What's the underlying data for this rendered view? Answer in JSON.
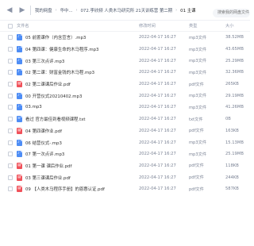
{
  "breadcrumb": [
    "我的网盘",
    "华中...",
    "072.李欣频 人类木马研究所 21天训练营 第二期",
    "01 主课"
  ],
  "search": {
    "placeholder": "搜索我的网盘文件"
  },
  "columns": {
    "name": "文件名",
    "modified": "修改时间",
    "type": "类型",
    "size": "大小"
  },
  "files": [
    {
      "name": "05 前置课作（内含宣言）.mp3",
      "modified": "2022-04-17 16:27",
      "type": "mp3文件",
      "size": "38.52MB",
      "icon": "audio"
    },
    {
      "name": "04 第四课：健康生命的木马程序.mp3",
      "modified": "2022-04-17 16:27",
      "type": "mp3文件",
      "size": "43.65MB",
      "icon": "audio"
    },
    {
      "name": "03 第三次点评.mp3",
      "modified": "2022-04-17 16:27",
      "type": "mp3文件",
      "size": "25.29MB",
      "icon": "audio"
    },
    {
      "name": "02 第二课：财富金钱的木马程.mp3",
      "modified": "2022-04-17 16:27",
      "type": "mp3文件",
      "size": "32.36MB",
      "icon": "audio"
    },
    {
      "name": "02 第二课课后作业.pdf",
      "modified": "2022-04-17 16:27",
      "type": "pdf文件",
      "size": "265KB",
      "icon": "pdf"
    },
    {
      "name": "00 开营仪式20210402.mp3",
      "modified": "2022-04-17 16:27",
      "type": "mp3文件",
      "size": "29.19MB",
      "icon": "audio"
    },
    {
      "name": "03.mp3",
      "modified": "2022-04-17 16:27",
      "type": "mp3文件",
      "size": "41.26MB",
      "icon": "audio"
    },
    {
      "name": "看过 官方最佳到看视频课程.txt",
      "modified": "2022-04-17 16:27",
      "type": "txt文件",
      "size": "0B",
      "icon": "txt"
    },
    {
      "name": "04 第四课作业.pdf",
      "modified": "2022-04-17 16:27",
      "type": "pdf文件",
      "size": "163KB",
      "icon": "pdf"
    },
    {
      "name": "06 结营仪式-.mp3",
      "modified": "2022-04-17 16:27",
      "type": "mp3文件",
      "size": "15.13MB",
      "icon": "audio"
    },
    {
      "name": "07 第一次点评.mp3",
      "modified": "2022-04-17 16:27",
      "type": "mp3文件",
      "size": "25.19MB",
      "icon": "audio"
    },
    {
      "name": "01 第一课 课后作业.pdf",
      "modified": "2022-04-17 16:27",
      "type": "pdf文件",
      "size": "118KB",
      "icon": "pdf"
    },
    {
      "name": "03 第三课课后作业.pdf",
      "modified": "2022-04-17 16:27",
      "type": "pdf文件",
      "size": "244KB",
      "icon": "pdf"
    },
    {
      "name": "09 【人类木马程序手册】的恩惠认证.pdf",
      "modified": "2022-04-17 16:27",
      "type": "pdf文件",
      "size": "587KB",
      "icon": "pdf"
    }
  ],
  "colors": {
    "accent": "#4e8df5",
    "pdf": "#f0515a",
    "muted": "#7a8294"
  }
}
